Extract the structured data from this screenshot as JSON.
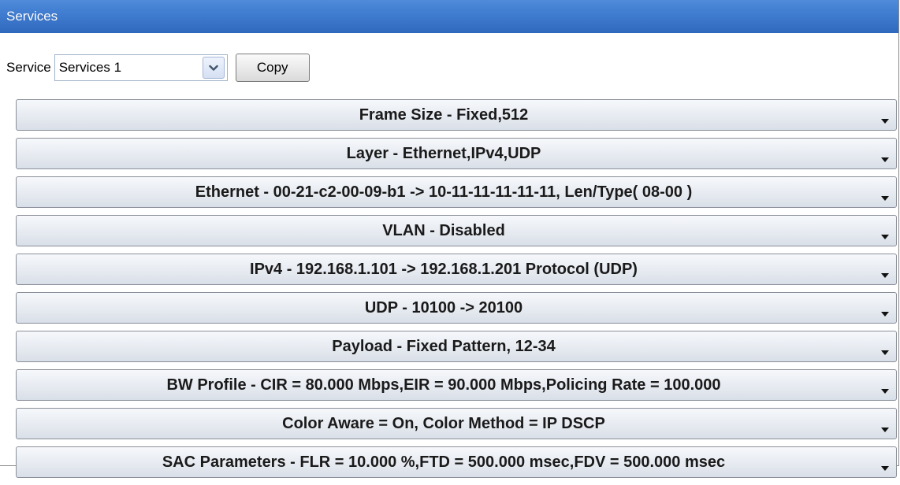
{
  "window": {
    "title": "Services"
  },
  "service_selector": {
    "label": "Service",
    "selected": "Services 1",
    "copy_label": "Copy"
  },
  "sections": [
    {
      "label": "Frame Size - Fixed,512"
    },
    {
      "label": "Layer - Ethernet,IPv4,UDP"
    },
    {
      "label": "Ethernet - 00-21-c2-00-09-b1 -> 10-11-11-11-11-11, Len/Type( 08-00 )"
    },
    {
      "label": "VLAN - Disabled"
    },
    {
      "label": "IPv4 - 192.168.1.101 -> 192.168.1.201 Protocol (UDP)"
    },
    {
      "label": "UDP - 10100 -> 20100"
    },
    {
      "label": "Payload - Fixed Pattern, 12-34"
    },
    {
      "label": "BW Profile - CIR = 80.000 Mbps,EIR = 90.000 Mbps,Policing Rate = 100.000"
    },
    {
      "label": "Color Aware = On, Color Method = IP DSCP"
    },
    {
      "label": "SAC Parameters - FLR = 10.000 %,FTD = 500.000 msec,FDV = 500.000 msec"
    }
  ],
  "icons": {
    "combo_arrow": "chevron-down-icon",
    "row_arrow": "triangle-down-icon"
  },
  "colors": {
    "titlebar": "#3f7bcf",
    "row_background": "#e8ecf2",
    "row_border": "#8a8f99"
  }
}
